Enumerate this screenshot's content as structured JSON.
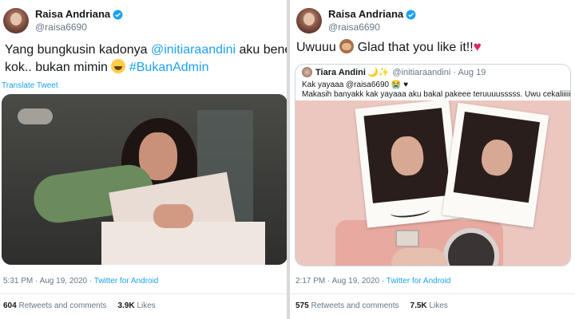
{
  "left_tweet": {
    "display_name": "Raisa Andriana",
    "handle": "@raisa6690",
    "text_line1_prefix": "Yang bungkusin kadonya ",
    "text_line1_mention": "@initiaraandini",
    "text_line1_suffix": " aku bener",
    "text_line2_prefix": "kok.. bukan mimin ",
    "text_line2_hashtag": "#BukanAdmin",
    "translate_label": "Translate Tweet",
    "time": "5:31 PM · Aug 19, 2020 · ",
    "source": "Twitter for Android",
    "retweets_count": "604",
    "retweets_label": "Retweets and comments",
    "likes_count": "3.9K",
    "likes_label": "Likes"
  },
  "right_tweet": {
    "display_name": "Raisa Andriana",
    "handle": "@raisa6690",
    "text_prefix": "Uwuuu ",
    "text_suffix": " Glad that you like it!!",
    "heart": "♥",
    "quoted": {
      "display_name": "Tiara Andini",
      "name_emoji": "🌙✨",
      "meta": "@initiaraandini · Aug 19",
      "line1": "Kak yayaaa @raisa6690 😭 ♥",
      "line2": "Makasih banyakk kak yayaaa aku bakal pakeee teruuuusssss. Uwu cekaliiiiiiuu:("
    },
    "time": "2:17 PM · Aug 19, 2020 · ",
    "source": "Twitter for Android",
    "retweets_count": "575",
    "retweets_label": "Retweets and comments",
    "likes_count": "7.5K",
    "likes_label": "Likes"
  },
  "colors": {
    "link": "#1da1f2",
    "muted": "#657786",
    "heart": "#e0245e"
  }
}
